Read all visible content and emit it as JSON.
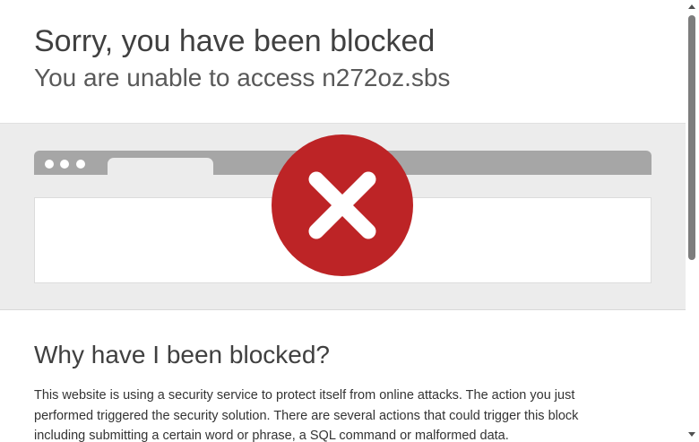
{
  "header": {
    "title": "Sorry, you have been blocked",
    "subtitle_prefix": "You are unable to access",
    "domain": "n272oz.sbs"
  },
  "illustration": {
    "icon": "blocked-x-circle-icon",
    "icon_color": "#bd2426"
  },
  "section": {
    "heading": "Why have I been blocked?",
    "body": "This website is using a security service to protect itself from online attacks. The action you just performed triggered the security solution. There are several actions that could trigger this block including submitting a certain word or phrase, a SQL command or malformed data."
  },
  "colors": {
    "band_background": "#ececec",
    "browser_bar": "#a6a6a6",
    "scrollbar_thumb": "#7d7d7d"
  }
}
